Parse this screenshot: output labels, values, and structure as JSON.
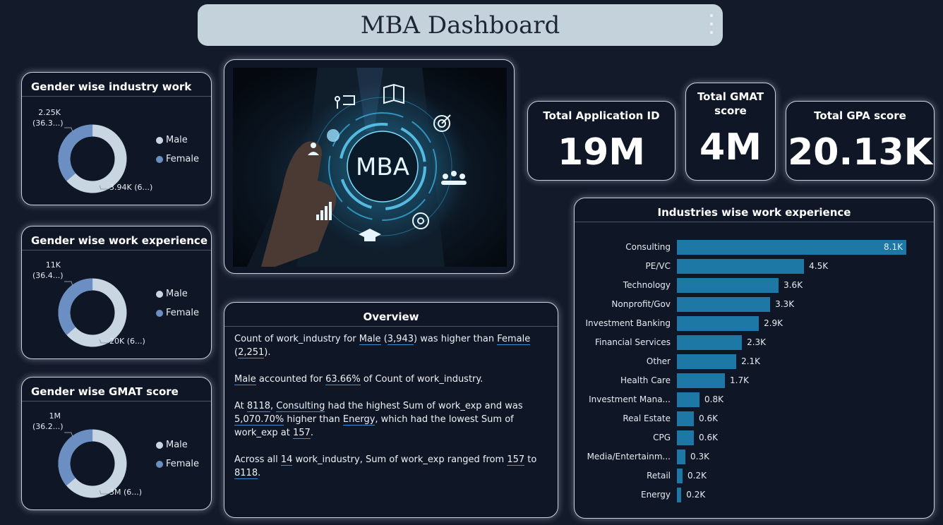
{
  "dashboard": {
    "title": "MBA Dashboard"
  },
  "gender_industry": {
    "title": "Gender wise industry work",
    "label_top_1": "2.25K",
    "label_top_2": "(36.3...)",
    "label_bottom": "3.94K (6...)",
    "male_fraction": 0.6366,
    "legend": [
      "Male",
      "Female"
    ]
  },
  "gender_experience": {
    "title": "Gender wise work experience",
    "label_top_1": "11K",
    "label_top_2": "(36.4...)",
    "label_bottom": "20K (6...)",
    "male_fraction": 0.636,
    "legend": [
      "Male",
      "Female"
    ]
  },
  "gender_gmat": {
    "title": "Gender wise GMAT score",
    "label_top_1": "1M",
    "label_top_2": "(36.2...)",
    "label_bottom": "3M (6...)",
    "male_fraction": 0.638,
    "legend": [
      "Male",
      "Female"
    ]
  },
  "colors": {
    "male": "#c8d6e2",
    "female": "#6b8fc3",
    "bar": "#1d78a6",
    "highlight_bar": "#1b77a8"
  },
  "image": {
    "text": "MBA"
  },
  "kpis": {
    "applications": {
      "title": "Total Application ID",
      "value": "19M"
    },
    "gmat": {
      "title_1": "Total GMAT",
      "title_2": "score",
      "value": "4M"
    },
    "gpa": {
      "title": "Total GPA score",
      "value": "20.13K"
    }
  },
  "overview": {
    "title": "Overview",
    "p1": {
      "a": "Count of work_industry for ",
      "b": "Male",
      "c": " (",
      "d": "3,943",
      "e": ") was higher than ",
      "f": "Female",
      "g": " (",
      "h": "2,251",
      "i": ")."
    },
    "p2": {
      "a": "Male",
      "b": " accounted for ",
      "c": "63.66%",
      "d": " of Count of work_industry."
    },
    "p3": {
      "a": "At ",
      "b": "8118",
      "c": ", ",
      "d": "Consulting",
      "e": " had the highest Sum of work_exp and was ",
      "f": "5,070.70%",
      "g": " higher than ",
      "h": "Energy",
      "i": ", which had the lowest Sum of work_exp at ",
      "j": "157",
      "k": "."
    },
    "p4": {
      "a": "Across all ",
      "b": "14",
      "c": " work_industry, Sum of work_exp ranged from ",
      "d": "157",
      "e": " to ",
      "f": "8118",
      "g": "."
    }
  },
  "chart_data": {
    "type": "bar",
    "orientation": "horizontal",
    "title": "Industries wise work experience",
    "categories": [
      "Consulting",
      "PE/VC",
      "Technology",
      "Nonprofit/Gov",
      "Investment Banking",
      "Financial Services",
      "Other",
      "Health Care",
      "Investment Mana...",
      "Real Estate",
      "CPG",
      "Media/Entertainm...",
      "Retail",
      "Energy"
    ],
    "values": [
      8118,
      4500,
      3600,
      3300,
      2900,
      2300,
      2100,
      1700,
      800,
      600,
      600,
      300,
      200,
      157
    ],
    "value_labels": [
      "8.1K",
      "4.5K",
      "3.6K",
      "3.3K",
      "2.9K",
      "2.3K",
      "2.1K",
      "1.7K",
      "0.8K",
      "0.6K",
      "0.6K",
      "0.3K",
      "0.2K",
      "0.2K"
    ],
    "xlim": [
      0,
      8118
    ],
    "grid": false
  }
}
